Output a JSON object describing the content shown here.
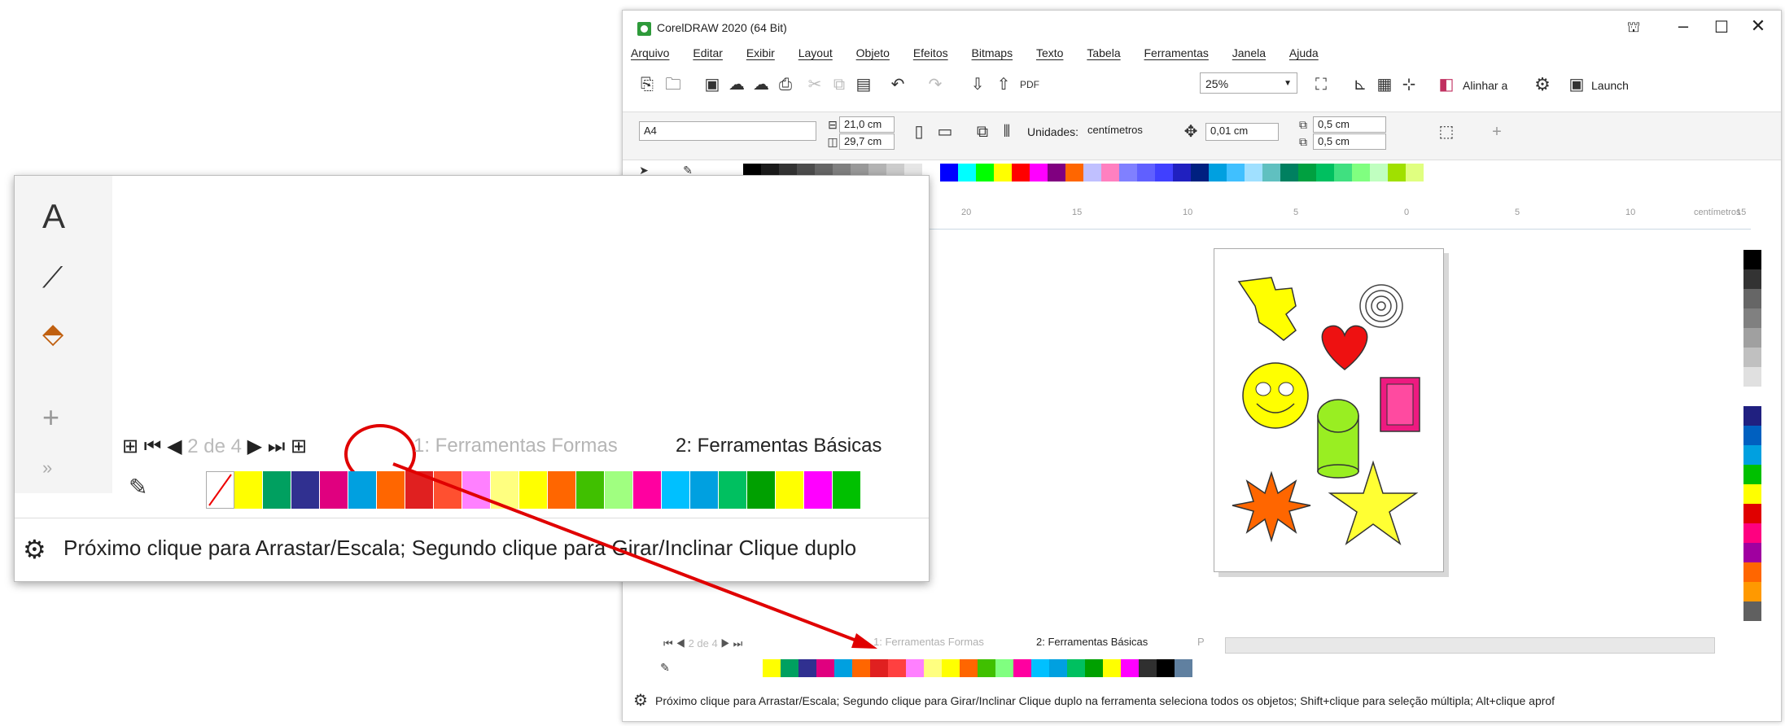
{
  "window": {
    "title": "CorelDRAW 2020 (64 Bit)",
    "menu": [
      "Arquivo",
      "Editar",
      "Exibir",
      "Layout",
      "Objeto",
      "Efeitos",
      "Bitmaps",
      "Texto",
      "Tabela",
      "Ferramentas",
      "Janela",
      "Ajuda"
    ],
    "zoom": "25%",
    "align_label": "Alinhar a",
    "launch_label": "Launch",
    "page_size": "A4",
    "width": "21,0 cm",
    "height": "29,7 cm",
    "units_label": "Unidades:",
    "units_value": "centímetros",
    "nudge": "0,01 cm",
    "dup_x": "0,5 cm",
    "dup_y": "0,5 cm",
    "ruler_ticks": [
      "20",
      "15",
      "10",
      "5",
      "0",
      "5",
      "10",
      "15",
      "20"
    ],
    "ruler_unit": "centímetros",
    "page_nav": "2 de 4",
    "tab1": "1: Ferramentas Formas",
    "tab2": "2: Ferramentas Básicas",
    "tab3": "P",
    "status": "Próximo clique para Arrastar/Escala; Segundo clique para Girar/Inclinar Clique duplo na ferramenta seleciona todos os objetos; Shift+clique para seleção múltipla; Alt+clique aprof"
  },
  "zoom_callout": {
    "page_of": "2",
    "page_de": "de 4",
    "tab1": "1: Ferramentas Formas",
    "tab2": "2: Ferramentas Básicas",
    "status": "Próximo clique para Arrastar/Escala; Segundo clique para Girar/Inclinar Clique duplo"
  },
  "colors": {
    "palette": [
      "#000000",
      "#1a1a1a",
      "#333333",
      "#4d4d4d",
      "#666666",
      "#808080",
      "#999999",
      "#b3b3b3",
      "#cccccc",
      "#e6e6e6",
      "#ffffff",
      "#0000ff",
      "#00ffff",
      "#00ff00",
      "#ffff00",
      "#ff0000",
      "#ff00ff",
      "#800080",
      "#ff6600",
      "#c0c0ff",
      "#ff80c0",
      "#8080ff",
      "#6060ff",
      "#4040ff",
      "#2020c0",
      "#002080",
      "#00a0e0",
      "#40c0ff",
      "#a0e0ff",
      "#60c0c0",
      "#008060",
      "#00a040",
      "#00c060",
      "#40e080",
      "#80ff80",
      "#c0ffc0",
      "#a0e000",
      "#e0ff80"
    ],
    "bottom_palette": [
      "#ffff00",
      "#00a060",
      "#303090",
      "#e0007f",
      "#00a0e0",
      "#ff6600",
      "#e02020",
      "#ff4040",
      "#ff80ff",
      "#ffff80",
      "#ffff00",
      "#ff6600",
      "#40c000",
      "#80ff80",
      "#ff00a0",
      "#00c0ff",
      "#00a0e0",
      "#00c060",
      "#00a000",
      "#ffff00",
      "#ff00ff",
      "#303030",
      "#000000",
      "#6080a0"
    ],
    "zoom_palette": [
      "#ffff00",
      "#00a060",
      "#303090",
      "#e0007f",
      "#00a0e0",
      "#ff6600",
      "#e02020",
      "#ff5030",
      "#ff80ff",
      "#ffff80",
      "#ffff00",
      "#ff6600",
      "#40c000",
      "#a0ff80",
      "#ff00a0",
      "#00c0ff",
      "#00a0e0",
      "#00c060",
      "#00a000",
      "#ffff00",
      "#ff00ff",
      "#00c000"
    ],
    "right_palette": [
      "#ffffff",
      "#000000",
      "#333333",
      "#666666",
      "#808080",
      "#a0a0a0",
      "#c0c0c0",
      "#e0e0e0",
      "#ffffff",
      "#202080",
      "#0060c0",
      "#00a0e0",
      "#00c000",
      "#ffff00",
      "#e00000",
      "#ff0080",
      "#a000a0",
      "#ff6600",
      "#ff9900",
      "#606060"
    ]
  }
}
